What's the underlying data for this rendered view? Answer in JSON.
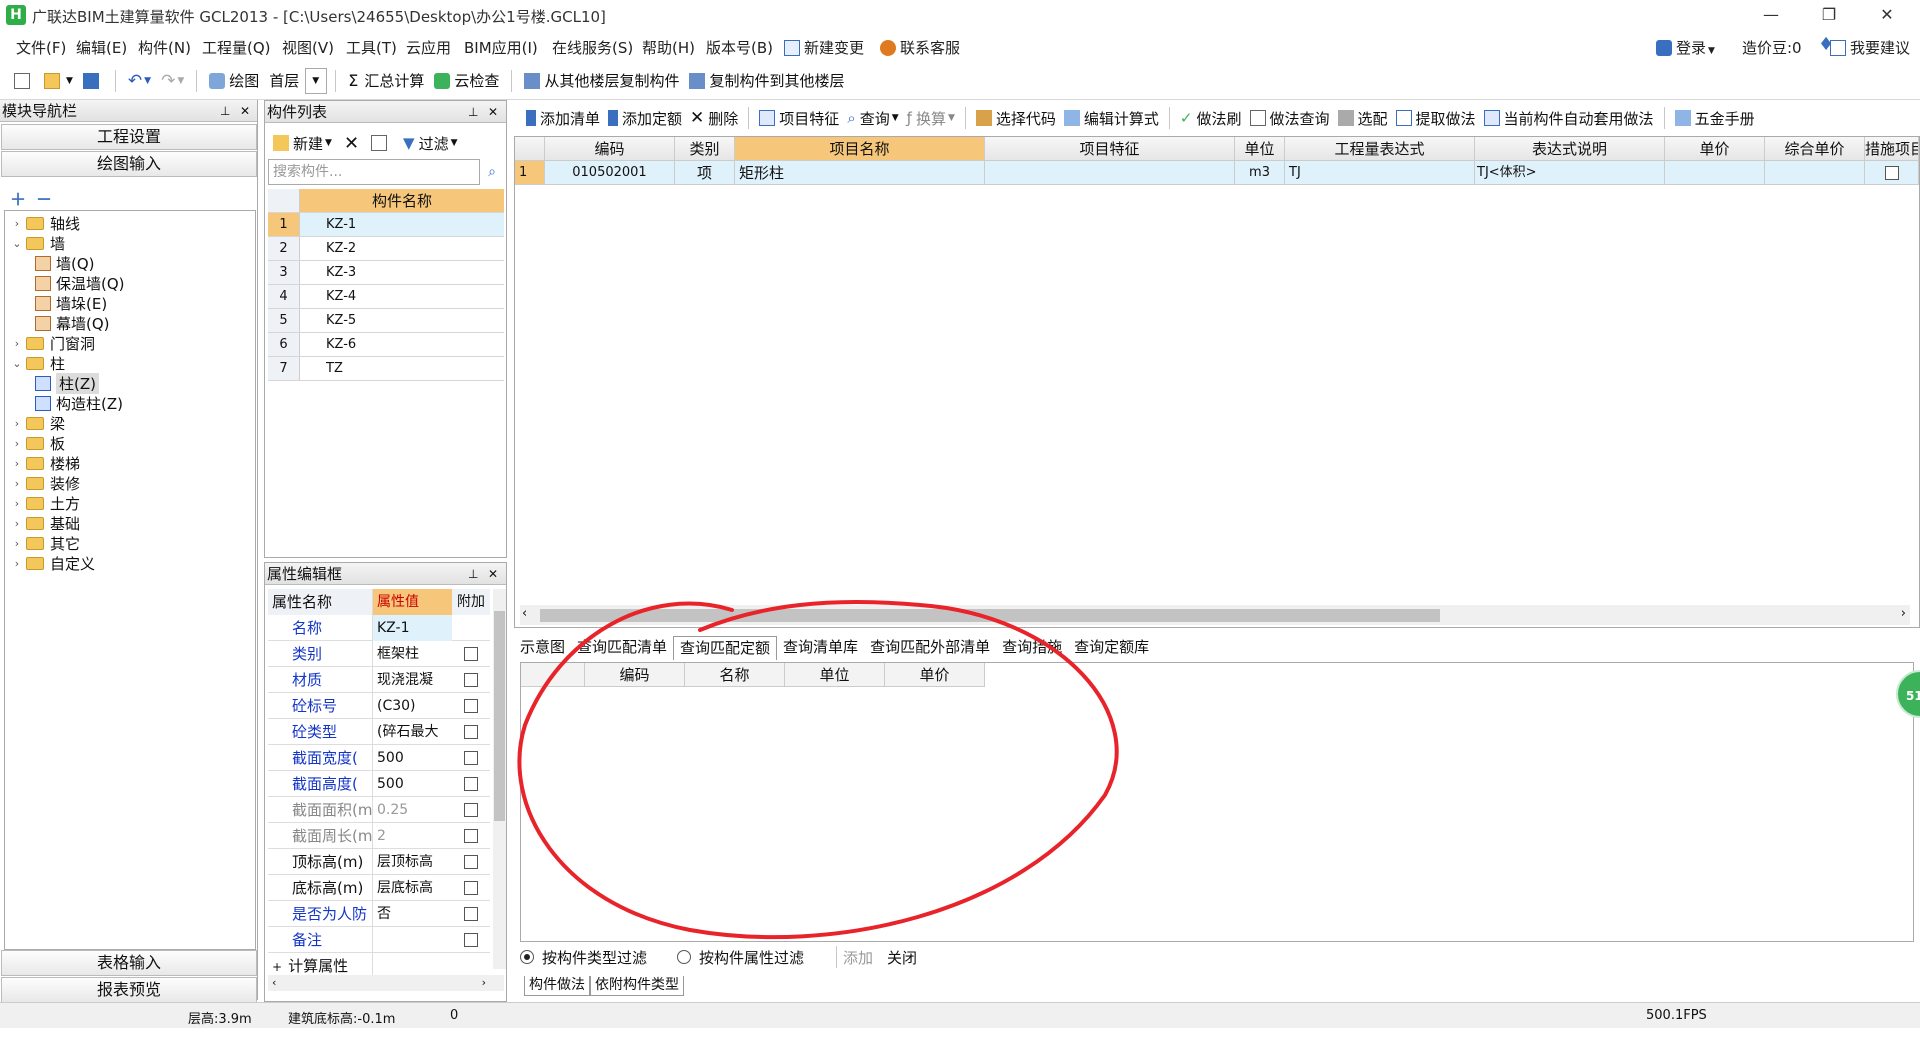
{
  "titlebar": {
    "app_logo": "H",
    "title": "广联达BIM土建算量软件 GCL2013 - [C:\\Users\\24655\\Desktop\\办公1号楼.GCL10]",
    "minimize": "—",
    "restore": "❐",
    "close": "✕"
  },
  "menu": [
    "文件(F)",
    "编辑(E)",
    "构件(N)",
    "工程量(Q)",
    "视图(V)",
    "工具(T)",
    "云应用",
    "BIM应用(I)",
    "在线服务(S)",
    "帮助(H)",
    "版本号(B)",
    "新建变更",
    "联系客服"
  ],
  "menu_right": {
    "login": "登录",
    "cost_beans": "造价豆:0",
    "feedback": "我要建议"
  },
  "toolbar1": {
    "draw": "绘图",
    "floor": "首层",
    "summary": "汇总计算",
    "cloud_check": "云检查",
    "copy_from": "从其他楼层复制构件",
    "copy_to": "复制构件到其他楼层"
  },
  "nav": {
    "title": "模块导航栏",
    "project_settings": "工程设置",
    "drawing_input": "绘图输入",
    "table_input": "表格输入",
    "report_preview": "报表预览",
    "tree": [
      {
        "label": "轴线",
        "level": 0,
        "expand": "›",
        "type": "folder"
      },
      {
        "label": "墙",
        "level": 0,
        "expand": "⌄",
        "type": "folder"
      },
      {
        "label": "墙(Q)",
        "level": 1,
        "type": "leaf"
      },
      {
        "label": "保温墙(Q)",
        "level": 1,
        "type": "leaf"
      },
      {
        "label": "墙垛(E)",
        "level": 1,
        "type": "leaf"
      },
      {
        "label": "幕墙(Q)",
        "level": 1,
        "type": "leaf"
      },
      {
        "label": "门窗洞",
        "level": 0,
        "expand": "›",
        "type": "folder"
      },
      {
        "label": "柱",
        "level": 0,
        "expand": "⌄",
        "type": "folder"
      },
      {
        "label": "柱(Z)",
        "level": 1,
        "type": "leaf-col"
      },
      {
        "label": "构造柱(Z)",
        "level": 1,
        "type": "leaf-col"
      },
      {
        "label": "梁",
        "level": 0,
        "expand": "›",
        "type": "folder"
      },
      {
        "label": "板",
        "level": 0,
        "expand": "›",
        "type": "folder"
      },
      {
        "label": "楼梯",
        "level": 0,
        "expand": "›",
        "type": "folder"
      },
      {
        "label": "装修",
        "level": 0,
        "expand": "›",
        "type": "folder"
      },
      {
        "label": "土方",
        "level": 0,
        "expand": "›",
        "type": "folder"
      },
      {
        "label": "基础",
        "level": 0,
        "expand": "›",
        "type": "folder"
      },
      {
        "label": "其它",
        "level": 0,
        "expand": "›",
        "type": "folder"
      },
      {
        "label": "自定义",
        "level": 0,
        "expand": "›",
        "type": "folder"
      }
    ]
  },
  "components": {
    "title": "构件列表",
    "new_btn": "新建",
    "filter_btn": "过滤",
    "search_placeholder": "搜索构件...",
    "col_name": "构件名称",
    "rows": [
      {
        "n": "1",
        "name": "KZ-1"
      },
      {
        "n": "2",
        "name": "KZ-2"
      },
      {
        "n": "3",
        "name": "KZ-3"
      },
      {
        "n": "4",
        "name": "KZ-4"
      },
      {
        "n": "5",
        "name": "KZ-5"
      },
      {
        "n": "6",
        "name": "KZ-6"
      },
      {
        "n": "7",
        "name": "TZ"
      }
    ]
  },
  "properties": {
    "title": "属性编辑框",
    "col_name": "属性名称",
    "col_value": "属性值",
    "col_extra": "附加",
    "rows": [
      {
        "name": "名称",
        "value": "KZ-1",
        "style": "blue",
        "cb": false
      },
      {
        "name": "类别",
        "value": "框架柱",
        "style": "blue",
        "cb": true
      },
      {
        "name": "材质",
        "value": "现浇混凝",
        "style": "blue",
        "cb": true
      },
      {
        "name": "砼标号",
        "value": "(C30)",
        "style": "blue",
        "cb": true
      },
      {
        "name": "砼类型",
        "value": "(碎石最大",
        "style": "blue",
        "cb": true
      },
      {
        "name": "截面宽度(",
        "value": "500",
        "style": "blue",
        "cb": true
      },
      {
        "name": "截面高度(",
        "value": "500",
        "style": "blue",
        "cb": true
      },
      {
        "name": "截面面积(m",
        "value": "0.25",
        "style": "gray",
        "cb": true
      },
      {
        "name": "截面周长(m",
        "value": "2",
        "style": "gray",
        "cb": true
      },
      {
        "name": "顶标高(m)",
        "value": "层顶标高",
        "style": "black",
        "cb": true
      },
      {
        "name": "底标高(m)",
        "value": "层底标高",
        "style": "black",
        "cb": true
      },
      {
        "name": "是否为人防",
        "value": "否",
        "style": "blue",
        "cb": true
      },
      {
        "name": "备注",
        "value": "",
        "style": "blue",
        "cb": true
      },
      {
        "name": "计算属性",
        "value": "",
        "style": "black",
        "cb": false,
        "expand": "+"
      }
    ]
  },
  "main_toolbar": [
    "添加清单",
    "添加定额",
    "删除",
    "项目特征",
    "查询",
    "换算",
    "选择代码",
    "编辑计算式",
    "做法刷",
    "做法查询",
    "选配",
    "提取做法",
    "当前构件自动套用做法",
    "五金手册"
  ],
  "grid": {
    "headers": [
      "",
      "编码",
      "类别",
      "项目名称",
      "项目特征",
      "单位",
      "工程量表达式",
      "表达式说明",
      "单价",
      "综合单价",
      "措施项目"
    ],
    "rows": [
      {
        "n": "1",
        "code": "010502001",
        "cat": "项",
        "name": "矩形柱",
        "feature": "",
        "unit": "m3",
        "expr": "TJ",
        "desc": "TJ<体积>",
        "price": "",
        "comp": "",
        "measure": false
      }
    ]
  },
  "lower_tabs": [
    "示意图",
    "查询匹配清单",
    "查询匹配定额",
    "查询清单库",
    "查询匹配外部清单",
    "查询措施",
    "查询定额库"
  ],
  "lower_active": "查询匹配定额",
  "subgrid_headers": [
    "编码",
    "名称",
    "单位",
    "单价"
  ],
  "filters": {
    "by_type": "按构件类型过滤",
    "by_attr": "按构件属性过滤",
    "add": "添加",
    "close": "关闭"
  },
  "bottom_tabs": [
    "构件做法",
    "依附构件类型"
  ],
  "status": {
    "floor_height": "层高:3.9m",
    "base_elev": "建筑底标高:-0.1m",
    "value": "0",
    "fps": "500.1FPS"
  },
  "badge": "51",
  "colors": {
    "accent": "#f6c77a",
    "selected_row": "#dff1fa",
    "annotation": "#e8232a",
    "label_blue": "#1436c8"
  }
}
